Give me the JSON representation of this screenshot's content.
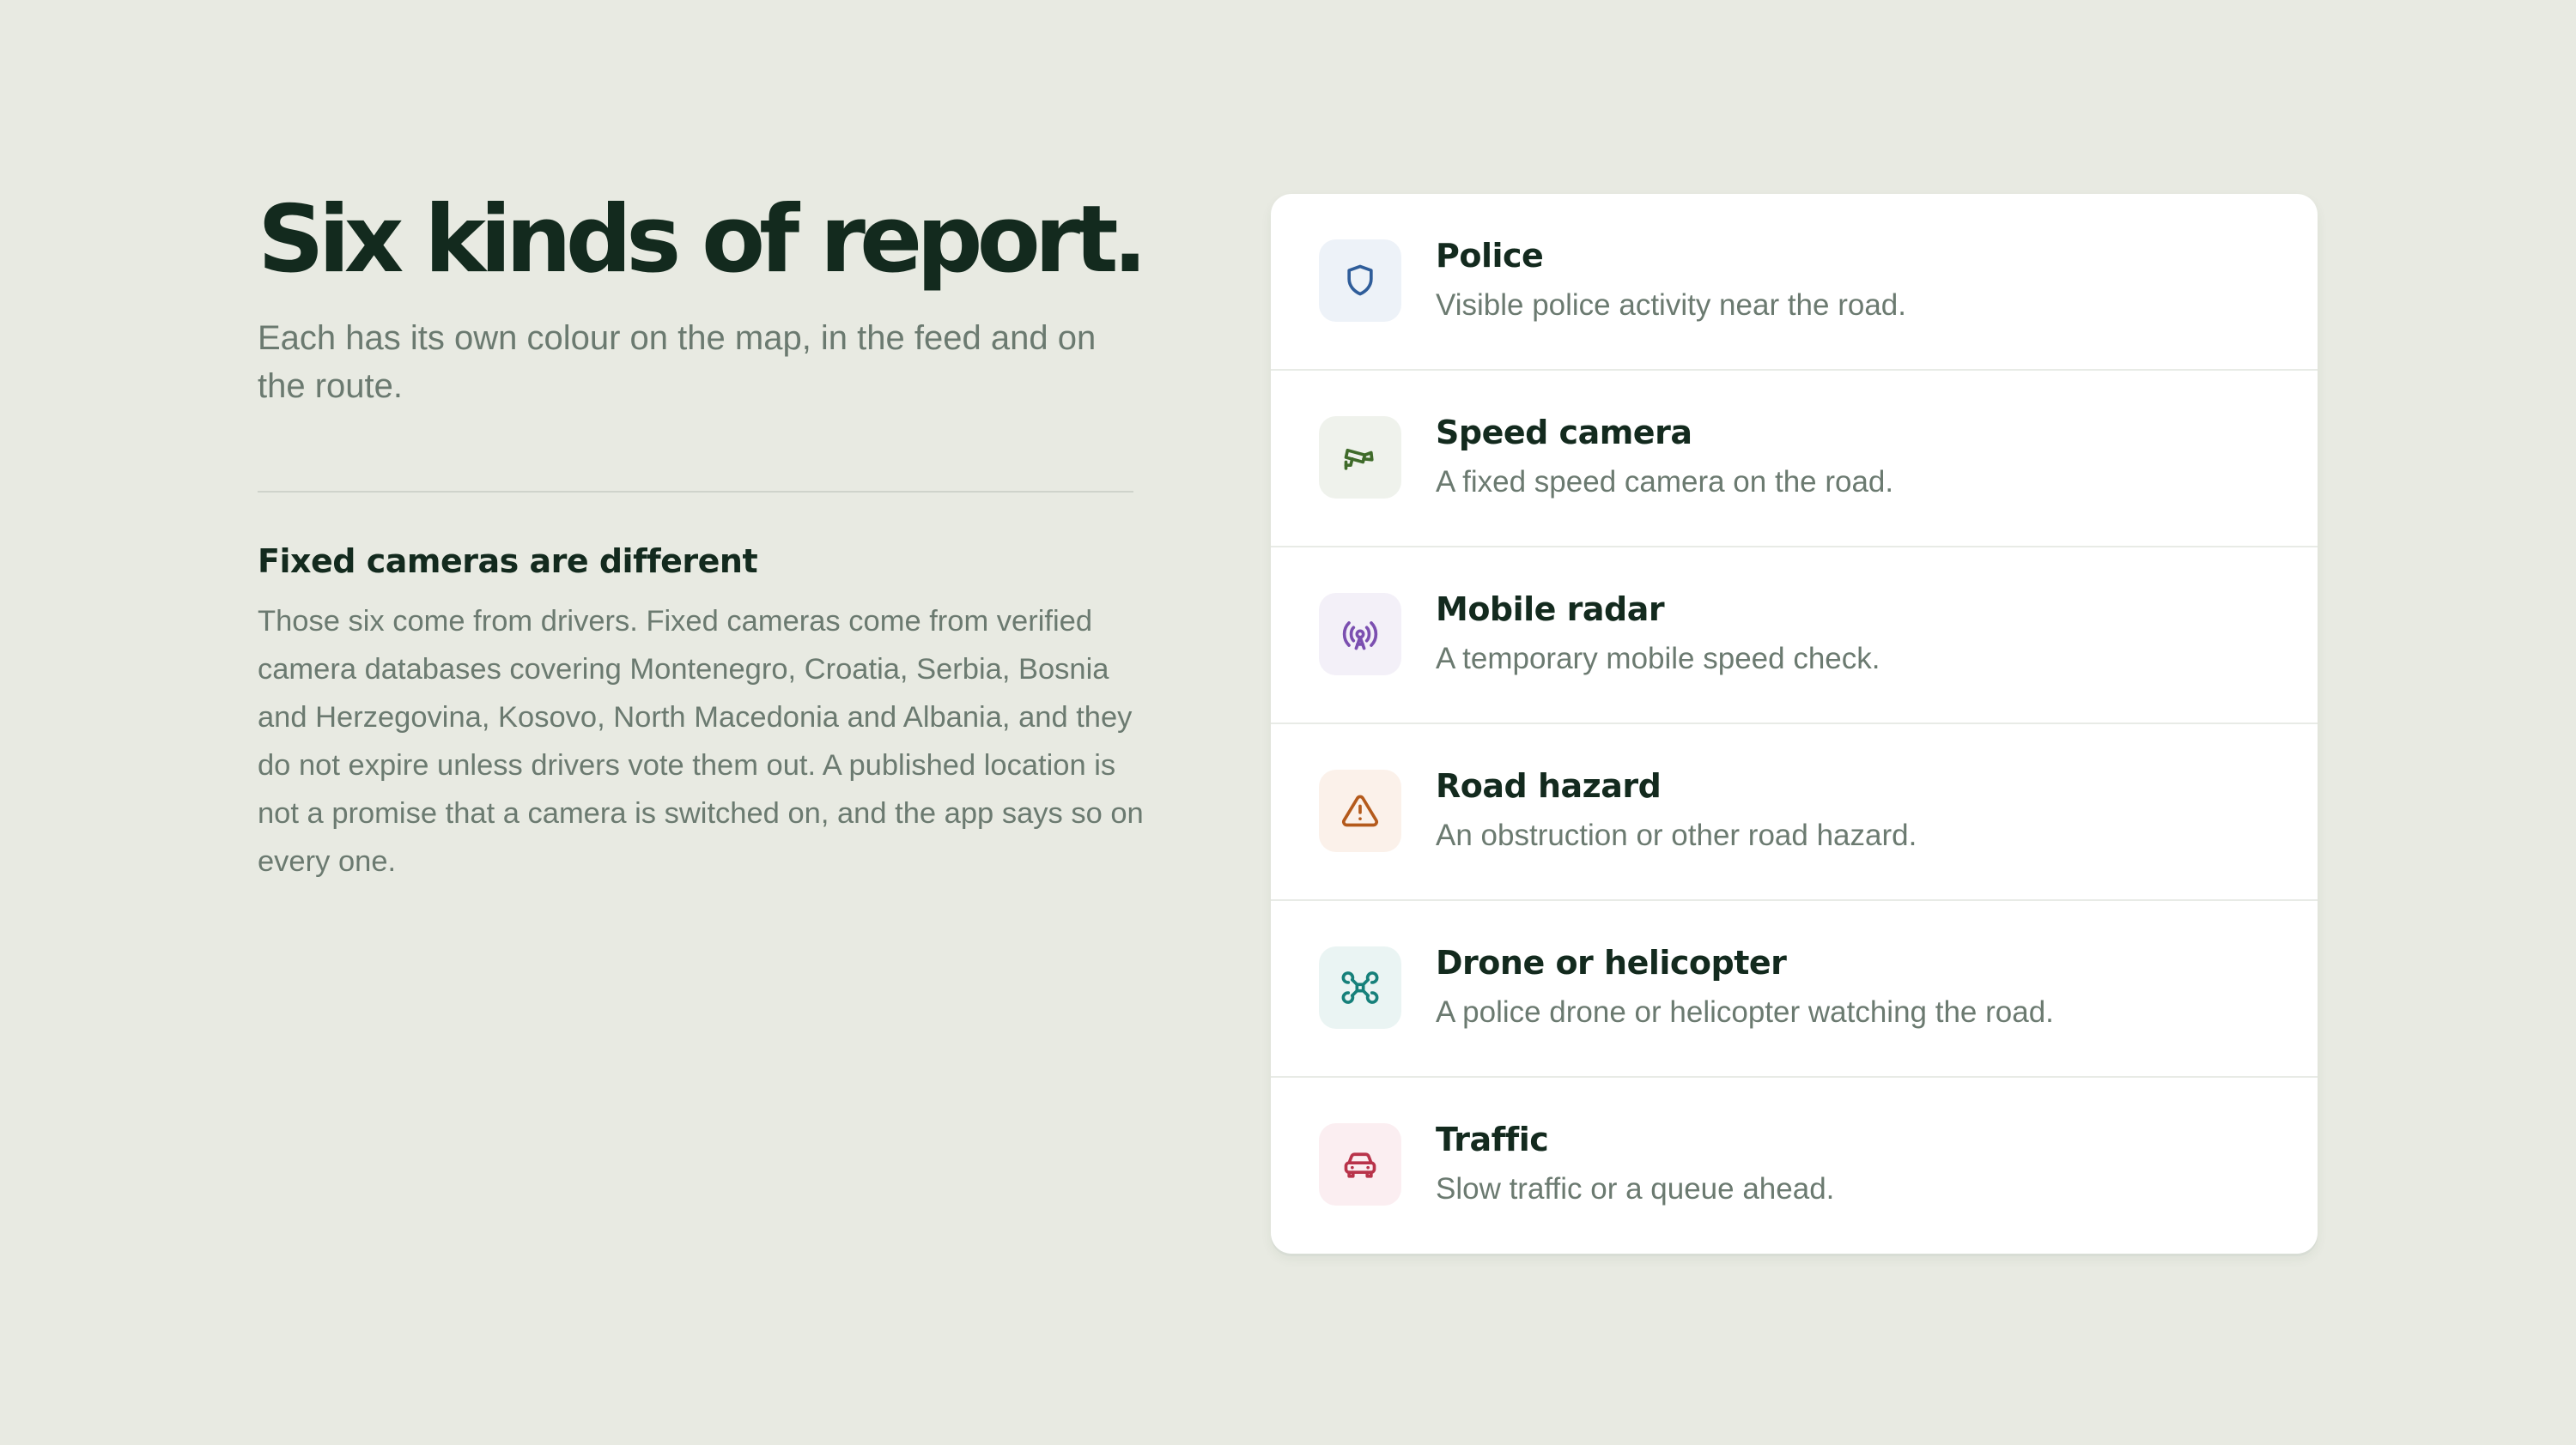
{
  "headline": "Six kinds of report.",
  "subtitle": "Each has its own colour on the map, in the feed and on the route.",
  "section": {
    "title": "Fixed cameras are different",
    "body": "Those six come from drivers. Fixed cameras come from verified camera databases covering Montenegro, Croatia, Serbia, Bosnia and Herzegovina, Kosovo, North Macedonia and Albania, and they do not expire unless drivers vote them out. A published location is not a promise that a camera is switched on, and the app says so on every one."
  },
  "reports": [
    {
      "title": "Police",
      "description": "Visible police activity near the road.",
      "icon": "shield-icon",
      "color": "#2f5d9a",
      "bg": "#edf2f8"
    },
    {
      "title": "Speed camera",
      "description": "A fixed speed camera on the road.",
      "icon": "cctv-camera-icon",
      "color": "#3f6b2a",
      "bg": "#eff2ec"
    },
    {
      "title": "Mobile radar",
      "description": "A temporary mobile speed check.",
      "icon": "radio-tower-icon",
      "color": "#7b4fb0",
      "bg": "#f3f0f8"
    },
    {
      "title": "Road hazard",
      "description": "An obstruction or other road hazard.",
      "icon": "warning-triangle-icon",
      "color": "#b45a1c",
      "bg": "#fbf1ea"
    },
    {
      "title": "Drone or helicopter",
      "description": "A police drone or helicopter watching the road.",
      "icon": "drone-icon",
      "color": "#16807a",
      "bg": "#eaf4f3"
    },
    {
      "title": "Traffic",
      "description": "Slow traffic or a queue ahead.",
      "icon": "car-icon",
      "color": "#b8334a",
      "bg": "#fbeef1"
    }
  ]
}
